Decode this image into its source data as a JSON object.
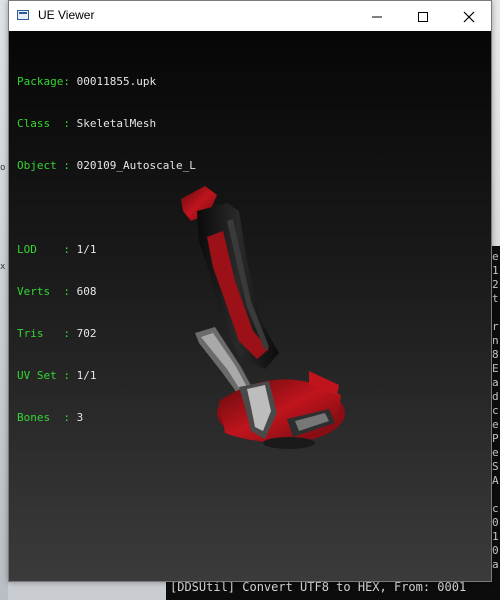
{
  "window": {
    "title": "UE Viewer"
  },
  "info": {
    "rows_top": [
      {
        "label": "Package: ",
        "value": "00011855.upk"
      },
      {
        "label": "Class  : ",
        "value": "SkeletalMesh"
      },
      {
        "label": "Object : ",
        "value": "020109_Autoscale_L"
      }
    ],
    "rows_bottom": [
      {
        "label": "LOD    : ",
        "value": "1/1"
      },
      {
        "label": "Verts  : ",
        "value": "608"
      },
      {
        "label": "Tris   : ",
        "value": "702"
      },
      {
        "label": "UV Set : ",
        "value": "1/1"
      },
      {
        "label": "Bones  : ",
        "value": "3"
      }
    ]
  },
  "console": {
    "bottom_line": "[DDSUtil] Convert UTF8 to HEX, From: 0001",
    "right_chars": [
      "e",
      "1",
      "2",
      "t",
      "",
      "r",
      "n",
      "8",
      "E",
      "a",
      "d",
      "c",
      "e",
      "P",
      "e",
      "S",
      "A",
      "",
      "c",
      "0",
      "1",
      "0",
      "a"
    ]
  },
  "background": {
    "left_marks": [
      "o",
      "x"
    ]
  },
  "colors": {
    "label_green": "#33d633",
    "value_text": "#e6e6e6",
    "mesh_red": "#b5121b"
  }
}
